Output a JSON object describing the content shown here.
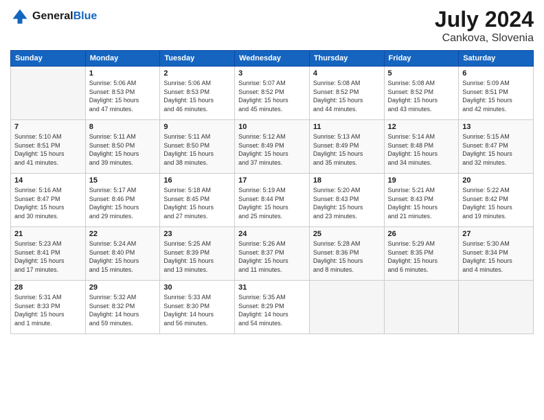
{
  "logo": {
    "text_general": "General",
    "text_blue": "Blue"
  },
  "header": {
    "title": "July 2024",
    "subtitle": "Cankova, Slovenia"
  },
  "columns": [
    "Sunday",
    "Monday",
    "Tuesday",
    "Wednesday",
    "Thursday",
    "Friday",
    "Saturday"
  ],
  "weeks": [
    [
      {
        "day": "",
        "info": ""
      },
      {
        "day": "1",
        "info": "Sunrise: 5:06 AM\nSunset: 8:53 PM\nDaylight: 15 hours\nand 47 minutes."
      },
      {
        "day": "2",
        "info": "Sunrise: 5:06 AM\nSunset: 8:53 PM\nDaylight: 15 hours\nand 46 minutes."
      },
      {
        "day": "3",
        "info": "Sunrise: 5:07 AM\nSunset: 8:52 PM\nDaylight: 15 hours\nand 45 minutes."
      },
      {
        "day": "4",
        "info": "Sunrise: 5:08 AM\nSunset: 8:52 PM\nDaylight: 15 hours\nand 44 minutes."
      },
      {
        "day": "5",
        "info": "Sunrise: 5:08 AM\nSunset: 8:52 PM\nDaylight: 15 hours\nand 43 minutes."
      },
      {
        "day": "6",
        "info": "Sunrise: 5:09 AM\nSunset: 8:51 PM\nDaylight: 15 hours\nand 42 minutes."
      }
    ],
    [
      {
        "day": "7",
        "info": "Sunrise: 5:10 AM\nSunset: 8:51 PM\nDaylight: 15 hours\nand 41 minutes."
      },
      {
        "day": "8",
        "info": "Sunrise: 5:11 AM\nSunset: 8:50 PM\nDaylight: 15 hours\nand 39 minutes."
      },
      {
        "day": "9",
        "info": "Sunrise: 5:11 AM\nSunset: 8:50 PM\nDaylight: 15 hours\nand 38 minutes."
      },
      {
        "day": "10",
        "info": "Sunrise: 5:12 AM\nSunset: 8:49 PM\nDaylight: 15 hours\nand 37 minutes."
      },
      {
        "day": "11",
        "info": "Sunrise: 5:13 AM\nSunset: 8:49 PM\nDaylight: 15 hours\nand 35 minutes."
      },
      {
        "day": "12",
        "info": "Sunrise: 5:14 AM\nSunset: 8:48 PM\nDaylight: 15 hours\nand 34 minutes."
      },
      {
        "day": "13",
        "info": "Sunrise: 5:15 AM\nSunset: 8:47 PM\nDaylight: 15 hours\nand 32 minutes."
      }
    ],
    [
      {
        "day": "14",
        "info": "Sunrise: 5:16 AM\nSunset: 8:47 PM\nDaylight: 15 hours\nand 30 minutes."
      },
      {
        "day": "15",
        "info": "Sunrise: 5:17 AM\nSunset: 8:46 PM\nDaylight: 15 hours\nand 29 minutes."
      },
      {
        "day": "16",
        "info": "Sunrise: 5:18 AM\nSunset: 8:45 PM\nDaylight: 15 hours\nand 27 minutes."
      },
      {
        "day": "17",
        "info": "Sunrise: 5:19 AM\nSunset: 8:44 PM\nDaylight: 15 hours\nand 25 minutes."
      },
      {
        "day": "18",
        "info": "Sunrise: 5:20 AM\nSunset: 8:43 PM\nDaylight: 15 hours\nand 23 minutes."
      },
      {
        "day": "19",
        "info": "Sunrise: 5:21 AM\nSunset: 8:43 PM\nDaylight: 15 hours\nand 21 minutes."
      },
      {
        "day": "20",
        "info": "Sunrise: 5:22 AM\nSunset: 8:42 PM\nDaylight: 15 hours\nand 19 minutes."
      }
    ],
    [
      {
        "day": "21",
        "info": "Sunrise: 5:23 AM\nSunset: 8:41 PM\nDaylight: 15 hours\nand 17 minutes."
      },
      {
        "day": "22",
        "info": "Sunrise: 5:24 AM\nSunset: 8:40 PM\nDaylight: 15 hours\nand 15 minutes."
      },
      {
        "day": "23",
        "info": "Sunrise: 5:25 AM\nSunset: 8:39 PM\nDaylight: 15 hours\nand 13 minutes."
      },
      {
        "day": "24",
        "info": "Sunrise: 5:26 AM\nSunset: 8:37 PM\nDaylight: 15 hours\nand 11 minutes."
      },
      {
        "day": "25",
        "info": "Sunrise: 5:28 AM\nSunset: 8:36 PM\nDaylight: 15 hours\nand 8 minutes."
      },
      {
        "day": "26",
        "info": "Sunrise: 5:29 AM\nSunset: 8:35 PM\nDaylight: 15 hours\nand 6 minutes."
      },
      {
        "day": "27",
        "info": "Sunrise: 5:30 AM\nSunset: 8:34 PM\nDaylight: 15 hours\nand 4 minutes."
      }
    ],
    [
      {
        "day": "28",
        "info": "Sunrise: 5:31 AM\nSunset: 8:33 PM\nDaylight: 15 hours\nand 1 minute."
      },
      {
        "day": "29",
        "info": "Sunrise: 5:32 AM\nSunset: 8:32 PM\nDaylight: 14 hours\nand 59 minutes."
      },
      {
        "day": "30",
        "info": "Sunrise: 5:33 AM\nSunset: 8:30 PM\nDaylight: 14 hours\nand 56 minutes."
      },
      {
        "day": "31",
        "info": "Sunrise: 5:35 AM\nSunset: 8:29 PM\nDaylight: 14 hours\nand 54 minutes."
      },
      {
        "day": "",
        "info": ""
      },
      {
        "day": "",
        "info": ""
      },
      {
        "day": "",
        "info": ""
      }
    ]
  ]
}
